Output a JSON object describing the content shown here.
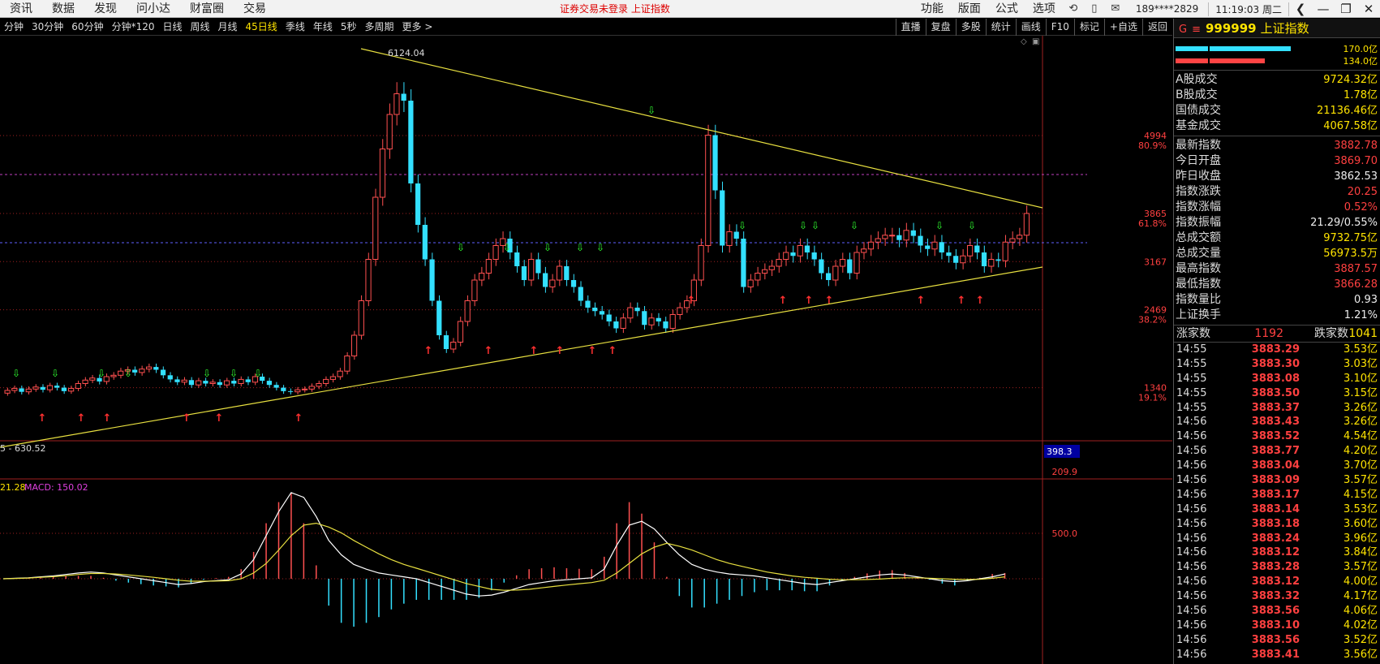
{
  "topbar": {
    "menu": [
      "资讯",
      "数据",
      "发现",
      "问小达",
      "财富圈",
      "交易"
    ],
    "notice": "证券交易未登录  上证指数",
    "right_menu": [
      "功能",
      "版面",
      "公式",
      "选项"
    ],
    "icons": [
      "refresh-icon",
      "phone-icon",
      "mail-icon"
    ],
    "user": "189****2829",
    "time": "11:19:03 周二",
    "window_buttons": [
      "back-icon",
      "minimize-icon",
      "restore-icon",
      "close-icon"
    ]
  },
  "periodbar": {
    "periods": [
      "分钟",
      "30分钟",
      "60分钟",
      "分钟*120",
      "日线",
      "周线",
      "月线",
      "45日线",
      "季线",
      "年线",
      "5秒",
      "多周期",
      "更多 >"
    ],
    "active": "45日线",
    "tools": [
      "直播",
      "复盘",
      "多股",
      "统计",
      "画线",
      "F10",
      "标记",
      "+自选",
      "返回"
    ]
  },
  "chart_data": {
    "type": "candlestick",
    "price_axis": {
      "labels": [
        "4994",
        "80.9%",
        "3865",
        "61.8%",
        "3167",
        "2469",
        "38.2%",
        "1340",
        "19.1%"
      ],
      "sub_labels": [
        "398.3",
        "209.9"
      ],
      "macd_label": "500.0"
    },
    "annotations": {
      "high": "6124.04",
      "low": "5 - 630.52",
      "macd_header_value": "21.28",
      "macd_header": "MACD: 150.02"
    },
    "closes": [
      1300,
      1330,
      1280,
      1320,
      1350,
      1310,
      1370,
      1340,
      1290,
      1330,
      1400,
      1450,
      1480,
      1430,
      1500,
      1520,
      1580,
      1600,
      1560,
      1610,
      1640,
      1600,
      1520,
      1460,
      1420,
      1450,
      1380,
      1440,
      1400,
      1420,
      1380,
      1440,
      1400,
      1460,
      1420,
      1500,
      1440,
      1380,
      1340,
      1290,
      1280,
      1310,
      1320,
      1360,
      1400,
      1460,
      1500,
      1580,
      1800,
      2100,
      2600,
      3200,
      4100,
      4800,
      5300,
      5600,
      5500,
      4300,
      3700,
      3200,
      2600,
      2100,
      1900,
      2000,
      2300,
      2600,
      2900,
      3000,
      3200,
      3400,
      3500,
      3300,
      3100,
      2900,
      3200,
      3000,
      2800,
      2900,
      3100,
      2900,
      2800,
      2600,
      2500,
      2450,
      2400,
      2300,
      2200,
      2350,
      2500,
      2450,
      2250,
      2350,
      2300,
      2200,
      2400,
      2500,
      2600,
      2900,
      3400,
      5000,
      4200,
      3400,
      3600,
      3500,
      2800,
      2900,
      3000,
      3050,
      3100,
      3200,
      3300,
      3250,
      3400,
      3300,
      3200,
      3000,
      2900,
      3100,
      3200,
      3000,
      3300,
      3350,
      3450,
      3500,
      3550,
      3550,
      3480,
      3620,
      3540,
      3400,
      3350,
      3450,
      3300,
      3250,
      3150,
      3250,
      3400,
      3300,
      3100,
      3200,
      3180,
      3450,
      3500,
      3550,
      3865
    ],
    "macd": {
      "dif": [
        0,
        5,
        10,
        20,
        30,
        45,
        60,
        70,
        60,
        40,
        20,
        0,
        -20,
        -40,
        -60,
        -50,
        -30,
        -20,
        -10,
        50,
        200,
        450,
        700,
        900,
        850,
        650,
        400,
        250,
        150,
        100,
        60,
        40,
        20,
        0,
        -40,
        -80,
        -120,
        -160,
        -180,
        -170,
        -140,
        -100,
        -60,
        -40,
        -20,
        -10,
        0,
        10,
        100,
        350,
        560,
        600,
        520,
        380,
        250,
        150,
        100,
        70,
        50,
        40,
        30,
        10,
        -10,
        -30,
        -50,
        -60,
        -40,
        -20,
        0,
        20,
        40,
        50,
        40,
        20,
        0,
        -20,
        -30,
        -20,
        0,
        20,
        50
      ],
      "dea": [
        0,
        3,
        8,
        15,
        22,
        32,
        45,
        55,
        55,
        50,
        40,
        28,
        15,
        0,
        -15,
        -25,
        -25,
        -24,
        -20,
        0,
        60,
        160,
        300,
        450,
        560,
        580,
        540,
        480,
        400,
        330,
        260,
        200,
        150,
        110,
        70,
        30,
        -10,
        -50,
        -80,
        -110,
        -120,
        -118,
        -110,
        -95,
        -80,
        -65,
        -52,
        -40,
        -15,
        60,
        160,
        260,
        330,
        370,
        340,
        300,
        250,
        200,
        160,
        130,
        100,
        70,
        50,
        30,
        15,
        5,
        -5,
        -10,
        -10,
        -8,
        -3,
        5,
        10,
        10,
        5,
        0,
        -5,
        -8,
        -5,
        5,
        20
      ],
      "hist": [
        0,
        4,
        4,
        10,
        16,
        26,
        30,
        30,
        10,
        -20,
        -40,
        -56,
        -70,
        -80,
        -90,
        -50,
        -10,
        8,
        20,
        100,
        280,
        580,
        800,
        900,
        580,
        140,
        -280,
        -460,
        -500,
        -460,
        -400,
        -320,
        -260,
        -220,
        -220,
        -220,
        -220,
        -220,
        -200,
        -120,
        -40,
        36,
        100,
        110,
        120,
        110,
        104,
        100,
        230,
        580,
        800,
        680,
        380,
        20,
        -180,
        -300,
        -300,
        -260,
        -220,
        -180,
        -140,
        -120,
        -120,
        -120,
        -130,
        -130,
        -70,
        -20,
        20,
        56,
        86,
        90,
        60,
        20,
        -10,
        -50,
        -70,
        -24,
        10,
        50,
        60
      ]
    }
  },
  "side": {
    "title_g": "G",
    "title_eq": "≡",
    "code": "999999",
    "name": "上证指数",
    "bar_values": [
      "170.0亿",
      "134.0亿"
    ],
    "group1": [
      {
        "label": "A股成交",
        "value": "9724.32亿",
        "cls": ""
      },
      {
        "label": "B股成交",
        "value": "1.78亿",
        "cls": ""
      },
      {
        "label": "国债成交",
        "value": "21136.46亿",
        "cls": ""
      },
      {
        "label": "基金成交",
        "value": "4067.58亿",
        "cls": ""
      }
    ],
    "group2": [
      {
        "label": "最新指数",
        "value": "3882.78",
        "cls": "red"
      },
      {
        "label": "今日开盘",
        "value": "3869.70",
        "cls": "red"
      },
      {
        "label": "昨日收盘",
        "value": "3862.53",
        "cls": "white"
      },
      {
        "label": "指数涨跌",
        "value": "20.25",
        "cls": "red"
      },
      {
        "label": "指数涨幅",
        "value": "0.52%",
        "cls": "red"
      },
      {
        "label": "指数振幅",
        "value": "21.29/0.55%",
        "cls": "white"
      },
      {
        "label": "总成交额",
        "value": "9732.75亿",
        "cls": ""
      },
      {
        "label": "总成交量",
        "value": "56973.5万",
        "cls": ""
      },
      {
        "label": "最高指数",
        "value": "3887.57",
        "cls": "red"
      },
      {
        "label": "最低指数",
        "value": "3866.28",
        "cls": "red"
      },
      {
        "label": "指数量比",
        "value": "0.93",
        "cls": "white"
      },
      {
        "label": "上证换手",
        "value": "1.21%",
        "cls": "white"
      }
    ],
    "updown": {
      "up_label": "涨家数",
      "up": "1192",
      "down_label": "跌家数",
      "down": "1041"
    },
    "ticks": [
      {
        "t": "14:55",
        "p": "3883.29",
        "a": "3.53亿"
      },
      {
        "t": "14:55",
        "p": "3883.30",
        "a": "3.03亿"
      },
      {
        "t": "14:55",
        "p": "3883.08",
        "a": "3.10亿"
      },
      {
        "t": "14:55",
        "p": "3883.50",
        "a": "3.15亿"
      },
      {
        "t": "14:55",
        "p": "3883.37",
        "a": "3.26亿"
      },
      {
        "t": "14:56",
        "p": "3883.43",
        "a": "3.26亿"
      },
      {
        "t": "14:56",
        "p": "3883.52",
        "a": "4.54亿"
      },
      {
        "t": "14:56",
        "p": "3883.77",
        "a": "4.20亿"
      },
      {
        "t": "14:56",
        "p": "3883.04",
        "a": "3.70亿"
      },
      {
        "t": "14:56",
        "p": "3883.09",
        "a": "3.57亿"
      },
      {
        "t": "14:56",
        "p": "3883.17",
        "a": "4.15亿"
      },
      {
        "t": "14:56",
        "p": "3883.14",
        "a": "3.53亿"
      },
      {
        "t": "14:56",
        "p": "3883.18",
        "a": "3.60亿"
      },
      {
        "t": "14:56",
        "p": "3883.24",
        "a": "3.96亿"
      },
      {
        "t": "14:56",
        "p": "3883.12",
        "a": "3.84亿"
      },
      {
        "t": "14:56",
        "p": "3883.28",
        "a": "3.57亿"
      },
      {
        "t": "14:56",
        "p": "3883.12",
        "a": "4.00亿"
      },
      {
        "t": "14:56",
        "p": "3883.32",
        "a": "4.17亿"
      },
      {
        "t": "14:56",
        "p": "3883.56",
        "a": "4.06亿"
      },
      {
        "t": "14:56",
        "p": "3883.10",
        "a": "4.02亿"
      },
      {
        "t": "14:56",
        "p": "3883.56",
        "a": "3.52亿"
      },
      {
        "t": "14:56",
        "p": "3883.41",
        "a": "3.56亿"
      }
    ]
  }
}
